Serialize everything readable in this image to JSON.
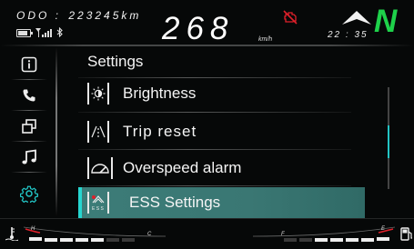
{
  "header": {
    "odo_label": "ODO :",
    "odo_value": "223245km",
    "speed": "268",
    "speed_unit": "km/h",
    "clock": "22 : 35",
    "gear": "N",
    "status_icons": [
      "battery-icon",
      "signal-icon",
      "bluetooth-icon",
      "engine-warning-icon",
      "navigation-arrow-icon"
    ]
  },
  "sidebar": {
    "items": [
      {
        "icon": "info-icon"
      },
      {
        "icon": "phone-icon"
      },
      {
        "icon": "windows-icon"
      },
      {
        "icon": "music-icon"
      },
      {
        "icon": "settings-gear-icon",
        "active": true
      }
    ]
  },
  "menu": {
    "title": "Settings",
    "items": [
      {
        "label": "Brightness",
        "icon": "brightness-icon"
      },
      {
        "label": "Trip reset",
        "icon": "trip-reset-icon"
      },
      {
        "label": "Overspeed alarm",
        "icon": "speedometer-icon"
      },
      {
        "label": "ESS Settings",
        "icon": "ess-icon",
        "selected": true
      }
    ]
  },
  "gauges": {
    "temperature": {
      "low_label": "H",
      "high_label": "C"
    },
    "fuel": {
      "low_label": "F",
      "high_label": "E"
    }
  },
  "colors": {
    "accent": "#22c4c4",
    "gear": "#1ed14a",
    "warning": "#e0202a",
    "selected_row": "#3a7773",
    "background": "#060808"
  }
}
